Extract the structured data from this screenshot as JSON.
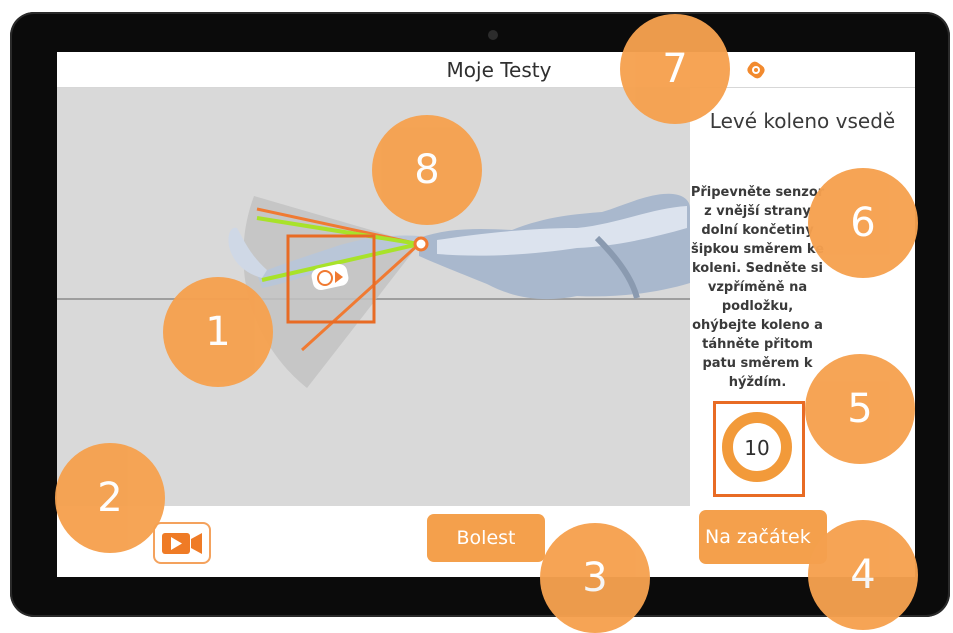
{
  "header": {
    "title": "Moje Testy"
  },
  "panel": {
    "exercise_title": "Levé koleno vsedě",
    "instructions": "Připevněte senzor z vnější strany dolní končetiny šipkou směrem ke koleni. Sedněte si vzpříměně na podložku, ohýbejte koleno a táhněte přitom patu směrem k hýždím.",
    "counter": "10"
  },
  "buttons": {
    "pain_label": "Bolest",
    "restart_label": "Na začátek"
  },
  "icons": {
    "sensor": "sensor-icon",
    "video": "video-camera-icon"
  },
  "markers": [
    "1",
    "2",
    "3",
    "4",
    "5",
    "6",
    "7",
    "8"
  ],
  "colors": {
    "accent": "#f29a3a",
    "marker": "#f6a14f",
    "highlight": "#e86b24",
    "leg_line": "#a8e22a",
    "viewport_bg": "#d9d9d9"
  }
}
